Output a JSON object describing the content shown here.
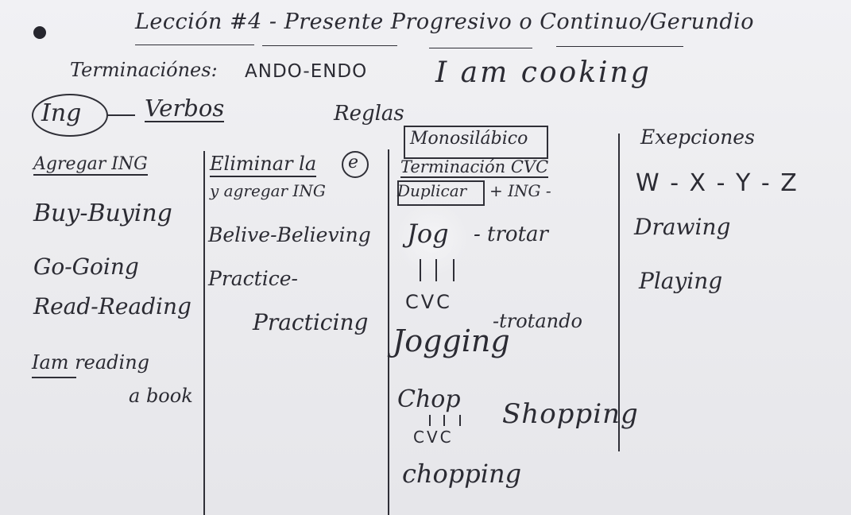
{
  "title": "Lección #4 - Presente Progresivo o Continuo/Gerundio",
  "terminaciones_label": "Terminaciónes:",
  "terminaciones_value": "ANDO-ENDO",
  "example": "I am cooking",
  "ing": "Ing",
  "verbos": "Verbos",
  "reglas": "Reglas",
  "col1": {
    "heading": "Agregar ING",
    "items": [
      "Buy-Buying",
      "Go-Going",
      "Read-Reading",
      "Iam reading",
      "a book"
    ]
  },
  "col2": {
    "heading_line1": "Eliminar la",
    "heading_circled": "e",
    "heading_line2": "y agregar ING",
    "items": [
      "Belive-Believing",
      "Practice-",
      "Practicing"
    ]
  },
  "col3": {
    "heading_boxed": "Monosilábico",
    "heading_line2": "Terminación CVC",
    "heading_line3_boxed": "Duplicar",
    "heading_line3_rest": "+ ING -",
    "items": [
      "Jog",
      "- trotar",
      "CVC",
      "-trotando",
      "Jogging",
      "Chop",
      "CVC",
      "Shopping",
      "chopping"
    ]
  },
  "col4": {
    "heading": "Exepciones",
    "items": [
      "W - X - Y - Z",
      "Drawing",
      "Playing"
    ]
  }
}
